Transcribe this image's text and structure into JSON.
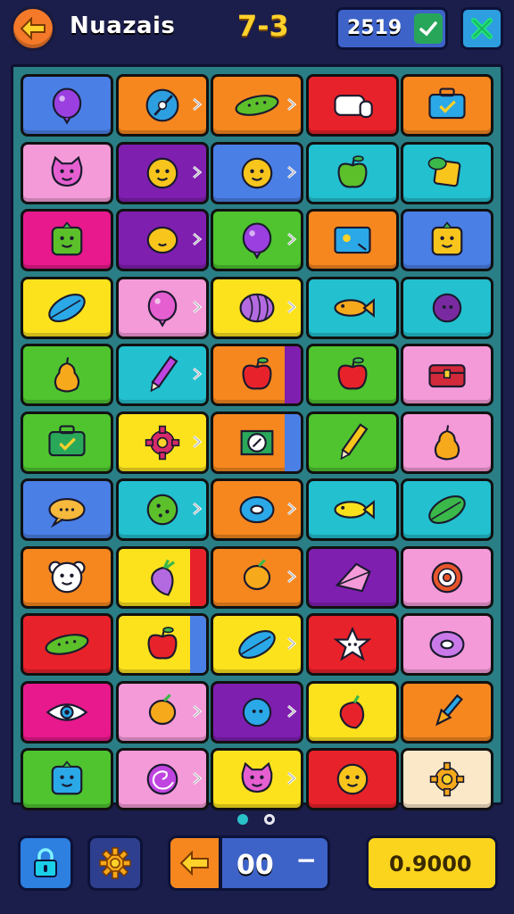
{
  "header": {
    "title": "Nuazais",
    "level": "7-3",
    "score": "2519"
  },
  "footer": {
    "counter": "00",
    "counter_suffix": "−",
    "coins": "0.9000"
  },
  "pager": {
    "pages": 2,
    "active": 0
  },
  "colors": {
    "blue": "#4a7fe6",
    "orange": "#f6871f",
    "green": "#4fc42f",
    "red": "#e8222b",
    "pink": "#f49ad8",
    "purple": "#7f1fb0",
    "cyan": "#23c0d0",
    "yellow": "#fbe21d",
    "magenta": "#e8198c",
    "cream": "#fbe8c8"
  },
  "board": {
    "rows": [
      [
        {
          "bg": "blue",
          "icon": "balloon-icon",
          "color": "#9b3fe0"
        },
        {
          "bg": "orange",
          "icon": "compass-icon",
          "color": "#2d9fe0",
          "arrow": true
        },
        {
          "bg": "orange",
          "icon": "cucumber-icon",
          "color": "#5cc02a",
          "arrow": true
        },
        {
          "bg": "red",
          "icon": "hand-icon",
          "color": "#ffffff"
        },
        {
          "bg": "orange",
          "icon": "suitcase-icon",
          "color": "#2aa8e8"
        }
      ],
      [
        {
          "bg": "pink",
          "icon": "cat-face-icon",
          "color": "#e55fd0"
        },
        {
          "bg": "purple",
          "icon": "smiley-icon",
          "color": "#f7c51c",
          "arrow": true
        },
        {
          "bg": "blue",
          "icon": "smiley-icon",
          "color": "#f7c51c",
          "arrow": true
        },
        {
          "bg": "cyan",
          "icon": "apple-icon",
          "color": "#5cc02a"
        },
        {
          "bg": "cyan",
          "icon": "note-icon",
          "color": "#f7c51c"
        }
      ],
      [
        {
          "bg": "magenta",
          "icon": "box-face-icon",
          "color": "#5cc02a"
        },
        {
          "bg": "purple",
          "icon": "lemon-icon",
          "color": "#f7c51c",
          "arrow": true
        },
        {
          "bg": "green",
          "icon": "balloon-icon",
          "color": "#9b3fe0",
          "arrow": true
        },
        {
          "bg": "orange",
          "icon": "picture-icon",
          "color": "#2aa8e8"
        },
        {
          "bg": "blue",
          "icon": "box-face-icon",
          "color": "#f7c51c"
        }
      ],
      [
        {
          "bg": "yellow",
          "icon": "leaf-icon",
          "color": "#2aa8e8"
        },
        {
          "bg": "pink",
          "icon": "balloon-icon",
          "color": "#e55fd0",
          "arrow": true
        },
        {
          "bg": "yellow",
          "icon": "shell-icon",
          "color": "#b36ae0",
          "arrow": true
        },
        {
          "bg": "cyan",
          "icon": "fish-icon",
          "color": "#f7a91c"
        },
        {
          "bg": "cyan",
          "icon": "plum-icon",
          "color": "#7a2aa0"
        }
      ],
      [
        {
          "bg": "green",
          "icon": "pear-icon",
          "color": "#f7a91c"
        },
        {
          "bg": "cyan",
          "icon": "pencil-icon",
          "color": "#c044e0",
          "arrow": true
        },
        {
          "bg": "orange",
          "icon": "apple-icon",
          "color": "#e8222b",
          "stripe": "purple"
        },
        {
          "bg": "green",
          "icon": "apple-icon",
          "color": "#e8222b"
        },
        {
          "bg": "pink",
          "icon": "chest-icon",
          "color": "#d22a3a"
        }
      ],
      [
        {
          "bg": "green",
          "icon": "suitcase-icon",
          "color": "#2aa85a"
        },
        {
          "bg": "yellow",
          "icon": "gear-icon",
          "color": "#d62a6a",
          "arrow": true
        },
        {
          "bg": "orange",
          "icon": "seal-icon",
          "color": "#2aa85a",
          "stripe": "blue"
        },
        {
          "bg": "green",
          "icon": "pencil-icon",
          "color": "#f7c51c"
        },
        {
          "bg": "pink",
          "icon": "pear-icon",
          "color": "#f7a91c"
        }
      ],
      [
        {
          "bg": "blue",
          "icon": "bubble-icon",
          "color": "#f7b93c"
        },
        {
          "bg": "cyan",
          "icon": "ball-icon",
          "color": "#5cc02a",
          "arrow": true
        },
        {
          "bg": "orange",
          "icon": "donut-icon",
          "color": "#2aa8e8",
          "arrow": true
        },
        {
          "bg": "cyan",
          "icon": "fish-icon",
          "color": "#f7e11c"
        },
        {
          "bg": "cyan",
          "icon": "leaf-icon",
          "color": "#3bb84a"
        }
      ],
      [
        {
          "bg": "orange",
          "icon": "bear-icon",
          "color": "#ffffff"
        },
        {
          "bg": "yellow",
          "icon": "radish-icon",
          "color": "#b36ae0",
          "stripe": "red"
        },
        {
          "bg": "orange",
          "icon": "carrot-icon",
          "color": "#f7a91c",
          "arrow": true
        },
        {
          "bg": "purple",
          "icon": "kite-icon",
          "color": "#f49ad8"
        },
        {
          "bg": "pink",
          "icon": "target-icon",
          "color": "#e8552b"
        }
      ],
      [
        {
          "bg": "red",
          "icon": "cucumber-icon",
          "color": "#5cc02a"
        },
        {
          "bg": "yellow",
          "icon": "apple-icon",
          "color": "#e8222b",
          "stripe": "blue"
        },
        {
          "bg": "yellow",
          "icon": "leaf-icon",
          "color": "#2aa8e8",
          "arrow": true
        },
        {
          "bg": "red",
          "icon": "star-icon",
          "color": "#ffffff"
        },
        {
          "bg": "pink",
          "icon": "donut-icon",
          "color": "#c97ae8"
        }
      ],
      [
        {
          "bg": "magenta",
          "icon": "eye-icon",
          "color": "#ffffff"
        },
        {
          "bg": "pink",
          "icon": "carrot-icon",
          "color": "#f7a91c",
          "arrow": true
        },
        {
          "bg": "purple",
          "icon": "plum-icon",
          "color": "#2aa8e8",
          "arrow": true
        },
        {
          "bg": "yellow",
          "icon": "pepper-icon",
          "color": "#e8222b"
        },
        {
          "bg": "orange",
          "icon": "brush-icon",
          "color": "#2aa8e8"
        }
      ],
      [
        {
          "bg": "green",
          "icon": "box-face-icon",
          "color": "#2aa8e8"
        },
        {
          "bg": "pink",
          "icon": "swirl-icon",
          "color": "#c044e0",
          "arrow": true
        },
        {
          "bg": "yellow",
          "icon": "cat-face-icon",
          "color": "#e55fd0",
          "arrow": true
        },
        {
          "bg": "red",
          "icon": "smiley-icon",
          "color": "#f7c51c"
        },
        {
          "bg": "cream",
          "icon": "gear-icon",
          "color": "#f7a91c"
        }
      ]
    ]
  }
}
